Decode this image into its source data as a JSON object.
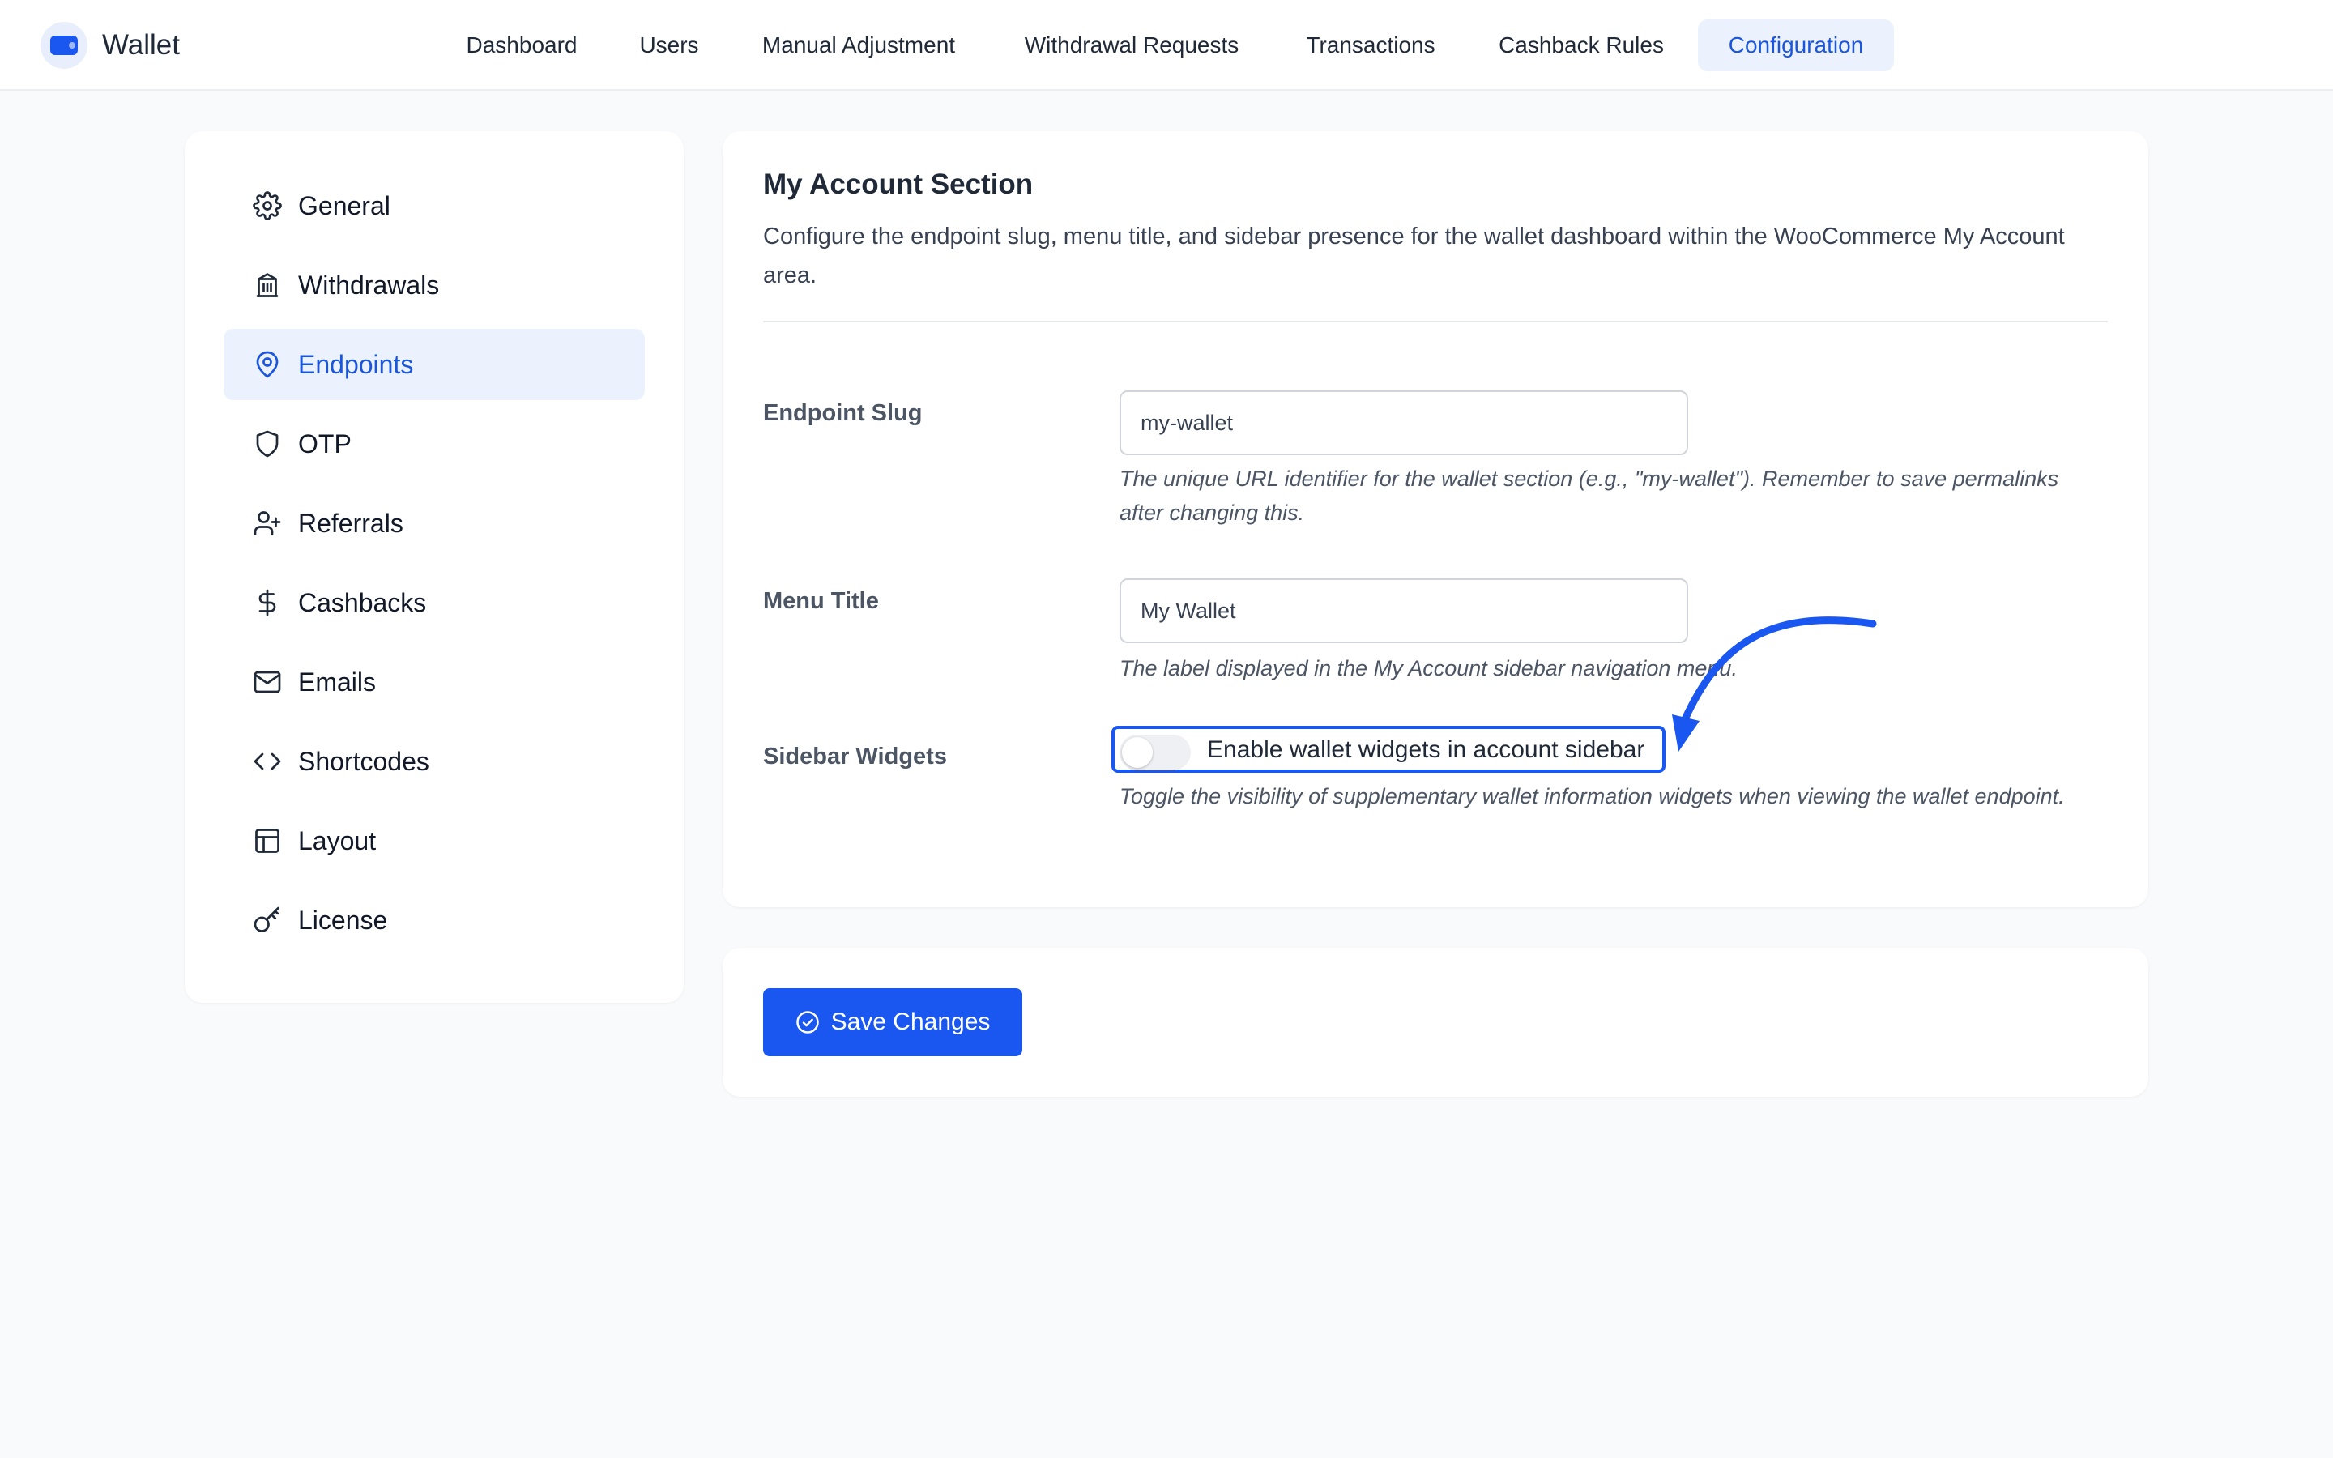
{
  "brand": {
    "name": "Wallet",
    "logo_icon": "wallet-icon"
  },
  "nav": {
    "tabs": [
      {
        "label": "Dashboard"
      },
      {
        "label": "Users"
      },
      {
        "label": "Manual Adjustment"
      },
      {
        "label": "Withdrawal Requests"
      },
      {
        "label": "Transactions"
      },
      {
        "label": "Cashback Rules"
      },
      {
        "label": "Configuration"
      }
    ],
    "active_tab": "Configuration"
  },
  "sidebar": {
    "active_item": "Endpoints",
    "items": [
      {
        "label": "General",
        "icon": "gear-icon"
      },
      {
        "label": "Withdrawals",
        "icon": "bank-icon"
      },
      {
        "label": "Endpoints",
        "icon": "map-pin-icon"
      },
      {
        "label": "OTP",
        "icon": "shield-icon"
      },
      {
        "label": "Referrals",
        "icon": "user-plus-icon"
      },
      {
        "label": "Cashbacks",
        "icon": "dollar-icon"
      },
      {
        "label": "Emails",
        "icon": "mail-icon"
      },
      {
        "label": "Shortcodes",
        "icon": "code-icon"
      },
      {
        "label": "Layout",
        "icon": "layout-icon"
      },
      {
        "label": "License",
        "icon": "key-icon"
      }
    ]
  },
  "section": {
    "title": "My Account Section",
    "description": "Configure the endpoint slug, menu title, and sidebar presence for the wallet dashboard within the WooCommerce My Account area."
  },
  "fields": {
    "endpoint_slug": {
      "label": "Endpoint Slug",
      "value": "my-wallet",
      "help": "The unique URL identifier for the wallet section (e.g., \"my-wallet\"). Remember to save permalinks after changing this."
    },
    "menu_title": {
      "label": "Menu Title",
      "value": "My Wallet",
      "help": "The label displayed in the My Account sidebar navigation menu."
    },
    "sidebar_widgets": {
      "label": "Sidebar Widgets",
      "toggle_label": "Enable wallet widgets in account sidebar",
      "enabled": false,
      "help": "Toggle the visibility of supplementary wallet information widgets when viewing the wallet endpoint."
    }
  },
  "actions": {
    "save_label": "Save Changes",
    "save_icon": "check-circle-icon"
  },
  "colors": {
    "accent": "#1a56f0",
    "active_bg": "#ebf1fd",
    "active_text": "#1a56db",
    "page_bg": "#f9fafb",
    "annotation": "#1a56f0"
  }
}
